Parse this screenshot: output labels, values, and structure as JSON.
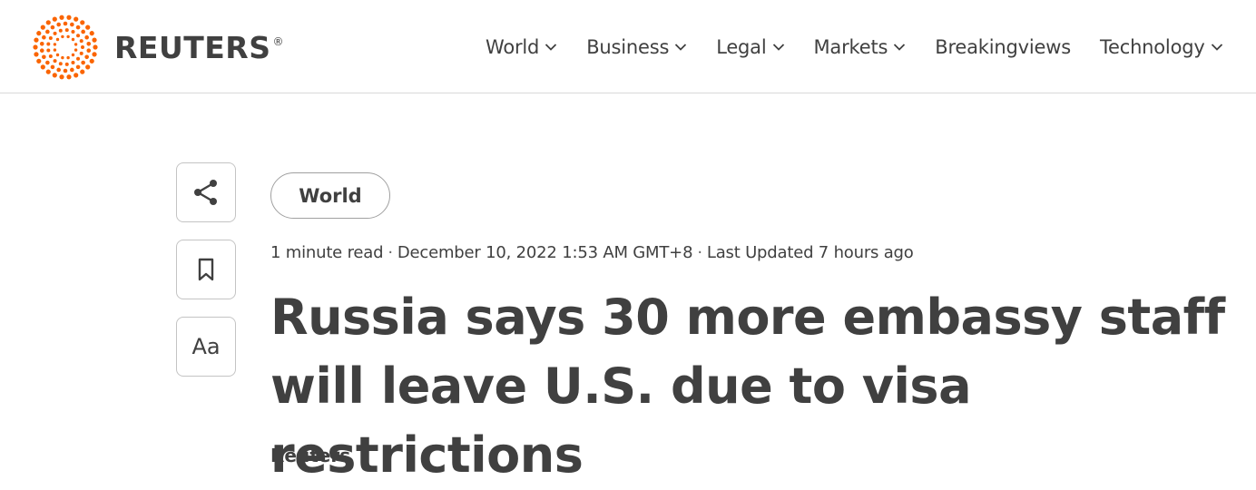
{
  "brand": {
    "name": "REUTERS",
    "registered_mark": "®",
    "accent_color": "#fa6400"
  },
  "nav": {
    "items": [
      {
        "label": "World",
        "has_dropdown": true
      },
      {
        "label": "Business",
        "has_dropdown": true
      },
      {
        "label": "Legal",
        "has_dropdown": true
      },
      {
        "label": "Markets",
        "has_dropdown": true
      },
      {
        "label": "Breakingviews",
        "has_dropdown": false
      },
      {
        "label": "Technology",
        "has_dropdown": true
      }
    ]
  },
  "sidebar": {
    "share_icon": "share-icon",
    "bookmark_icon": "bookmark-icon",
    "text_size_label": "Aa"
  },
  "article": {
    "section_tag": "World",
    "read_time": "1 minute read",
    "published": "December 10, 2022 1:53 AM GMT+8",
    "updated": "Last Updated 7 hours ago",
    "separator": "·",
    "headline": "Russia says 30 more embassy staff will leave U.S. due to visa restrictions",
    "byline": "Reuters"
  }
}
